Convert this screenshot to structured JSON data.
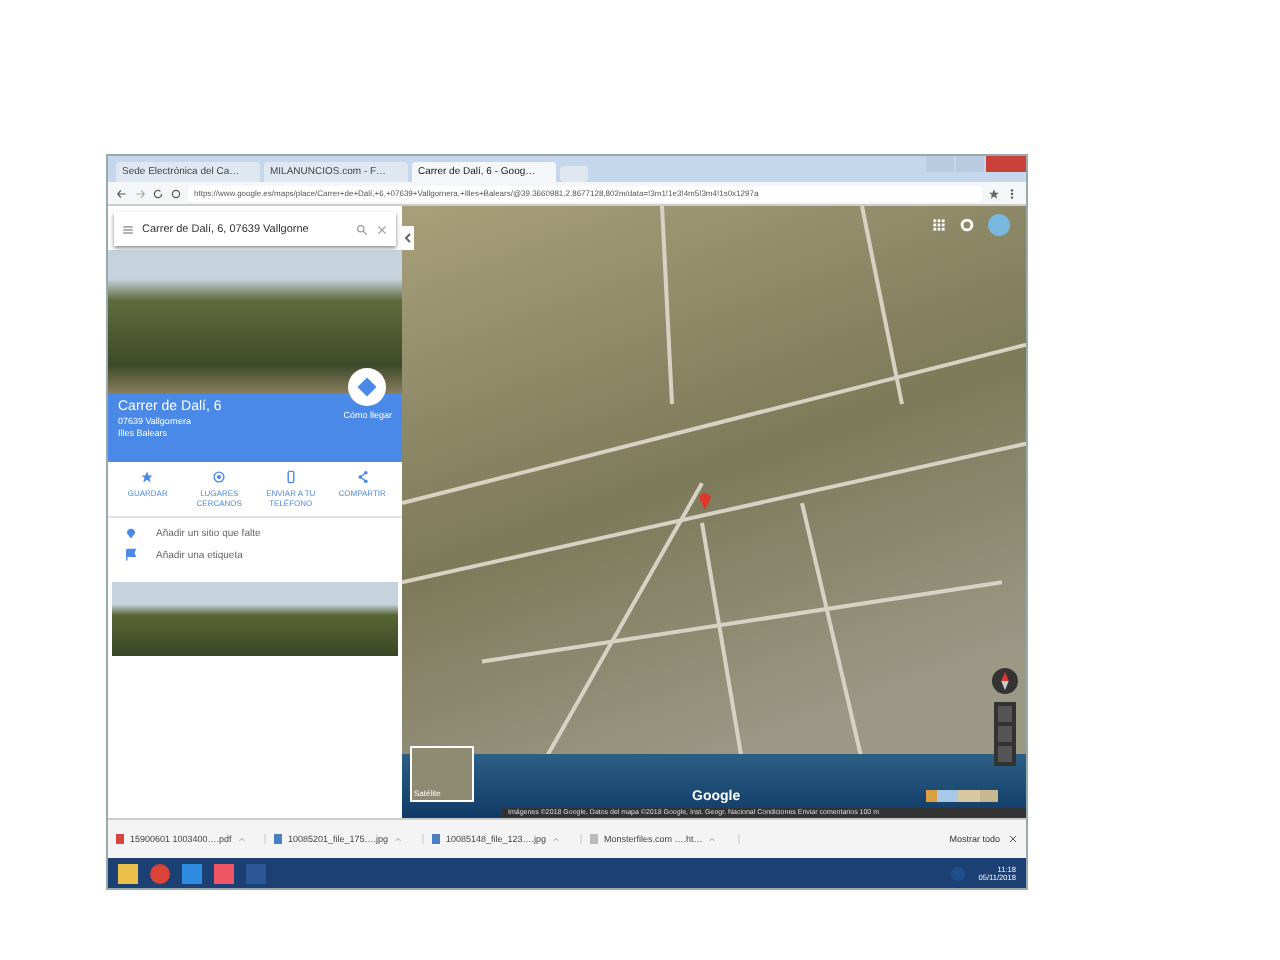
{
  "browser": {
    "tabs": [
      {
        "title": "Sede Electrónica del Ca…",
        "selected": false
      },
      {
        "title": "MILANUNCIOS.com - F…",
        "selected": false
      },
      {
        "title": "Carrer de Dalí, 6 - Goog…",
        "selected": true
      }
    ],
    "url": "https://www.google.es/maps/place/Carrer+de+Dalí,+6,+07639+Vallgornera,+Illes+Balears/@39.3660981,2.8677128,802m/data=!3m1!1e3!4m5!3m4!1s0x1297a"
  },
  "sidebar": {
    "search": {
      "value": "Carrer de Dalí, 6, 07639 Vallgorne"
    },
    "place": {
      "name": "Carrer de Dalí, 6",
      "postal": "07639 Vallgornera",
      "region": "Illes Balears",
      "directions": "Cómo llegar"
    },
    "actions": [
      {
        "label": "GUARDAR",
        "kind": "star"
      },
      {
        "label": "LUGARES CERCANOS",
        "kind": "nearby"
      },
      {
        "label": "ENVIAR A TU TELÉFONO",
        "kind": "phone"
      },
      {
        "label": "COMPARTIR",
        "kind": "share"
      }
    ],
    "suggestions": [
      {
        "label": "Añadir un sitio que falte",
        "kind": "pin"
      },
      {
        "label": "Añadir una etiqueta",
        "kind": "flag"
      }
    ]
  },
  "map": {
    "layer_label": "Satélite",
    "logo": "Google",
    "attribution": "Imágenes ©2018 Google, Datos del mapa ©2018 Google, Inst. Geogr. Nacional   Condiciones   Enviar comentarios   100 m"
  },
  "downloads": {
    "items": [
      {
        "name": "15900601 1003400….pdf",
        "kind": "pdf"
      },
      {
        "name": "10085201_file_175….jpg",
        "kind": "image"
      },
      {
        "name": "10085148_file_123….jpg",
        "kind": "image"
      },
      {
        "name": "Monsterfiles.com ….ht…",
        "kind": "page"
      }
    ],
    "show_all": "Mostrar todo"
  },
  "taskbar": {
    "time": "11:18",
    "date": "05/11/2018"
  }
}
